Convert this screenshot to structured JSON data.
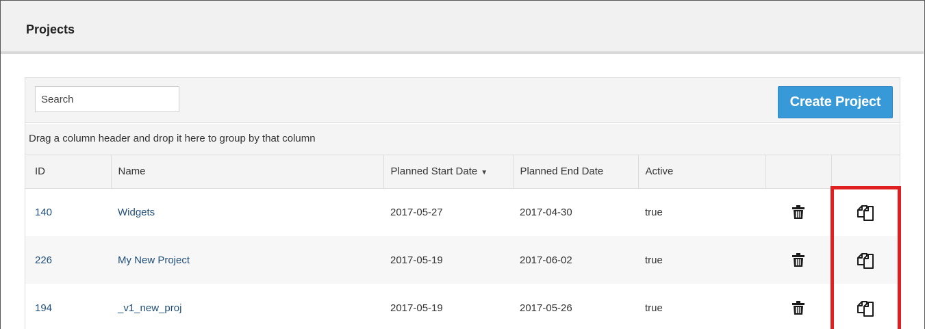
{
  "page": {
    "title": "Projects"
  },
  "toolbar": {
    "search_placeholder": "Search",
    "create_label": "Create Project"
  },
  "grid": {
    "group_hint": "Drag a column header and drop it here to group by that column",
    "columns": {
      "id": "ID",
      "name": "Name",
      "start": "Planned Start Date",
      "end": "Planned End Date",
      "active": "Active"
    },
    "sort": {
      "column": "Planned Start Date",
      "direction": "descending"
    },
    "rows": [
      {
        "id": "140",
        "name": "Widgets",
        "start": "2017-05-27",
        "end": "2017-04-30",
        "active": "true"
      },
      {
        "id": "226",
        "name": "My New Project",
        "start": "2017-05-19",
        "end": "2017-06-02",
        "active": "true"
      },
      {
        "id": "194",
        "name": "_v1_new_proj",
        "start": "2017-05-19",
        "end": "2017-05-26",
        "active": "true"
      }
    ]
  },
  "icons": {
    "delete": "trash-icon",
    "copy": "copy-icon",
    "sort": "sort-desc-icon"
  },
  "colors": {
    "accent_button": "#3899d8",
    "highlight": "#e02020",
    "link_text": "#1f4e79"
  }
}
